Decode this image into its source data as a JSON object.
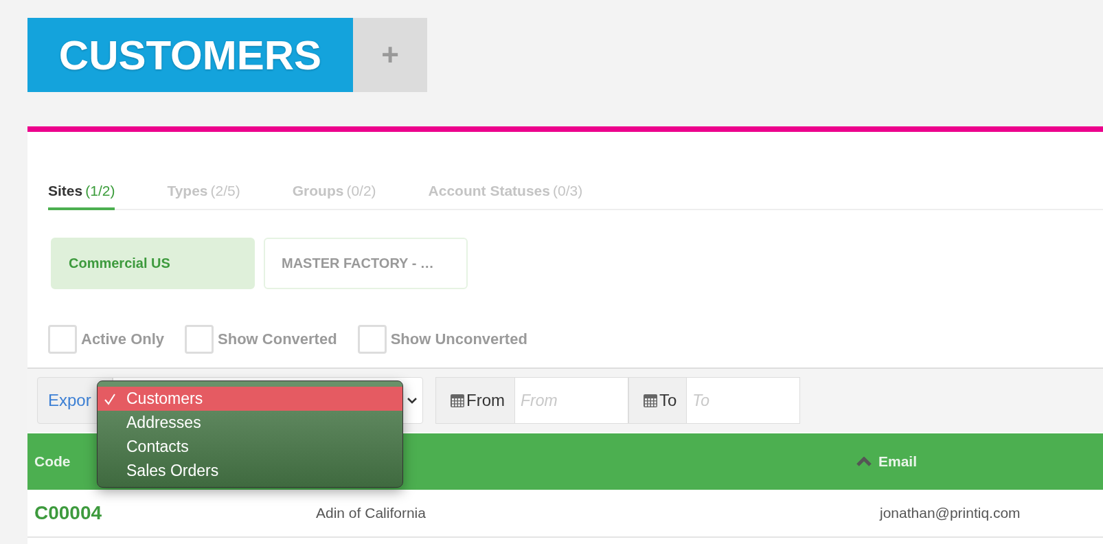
{
  "header": {
    "title": "CUSTOMERS",
    "add_label": "+"
  },
  "tabs": [
    {
      "label": "Sites",
      "count": "(1/2)",
      "selected": true
    },
    {
      "label": "Types",
      "count": "(2/5)",
      "selected": false
    },
    {
      "label": "Groups",
      "count": "(0/2)",
      "selected": false
    },
    {
      "label": "Account Statuses",
      "count": "(0/3)",
      "selected": false
    }
  ],
  "chips": [
    {
      "label": "Commercial US",
      "selected": true
    },
    {
      "label": "MASTER FACTORY - …",
      "selected": false
    }
  ],
  "filters": [
    {
      "label": "Active Only",
      "checked": false
    },
    {
      "label": "Show Converted",
      "checked": false
    },
    {
      "label": "Show Unconverted",
      "checked": false
    }
  ],
  "toolbar": {
    "export_label": "Expor",
    "export_menu": [
      {
        "label": "Customers",
        "selected": true
      },
      {
        "label": "Addresses",
        "selected": false
      },
      {
        "label": "Contacts",
        "selected": false
      },
      {
        "label": "Sales Orders",
        "selected": false
      }
    ],
    "from": {
      "label": "From",
      "placeholder": "From"
    },
    "to": {
      "label": "To",
      "placeholder": "To"
    }
  },
  "table": {
    "columns": [
      {
        "label": "Code",
        "sorted": false
      },
      {
        "label": "Email",
        "sorted": true
      }
    ],
    "rows": [
      {
        "code": "C00004",
        "name": "Adin of California",
        "email": "jonathan@printiq.com"
      }
    ]
  }
}
